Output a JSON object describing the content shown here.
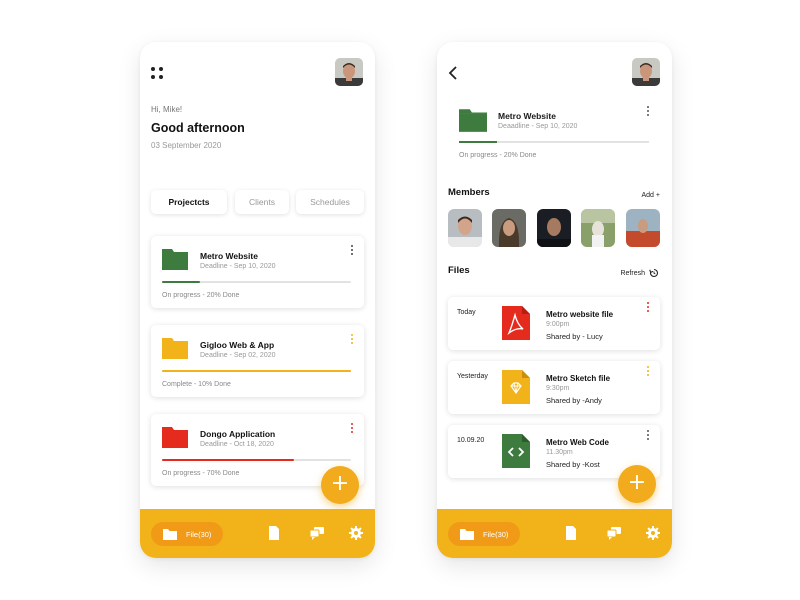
{
  "colors": {
    "accent": "#f1b21a",
    "accent_dark": "#f19a17",
    "green": "#3e7b3e",
    "yellow": "#f1b21a",
    "red": "#e52a1e"
  },
  "left": {
    "greeting_sub": "Hi, Mike!",
    "greeting_title": "Good afternoon",
    "date": "03 September 2020",
    "tabs": [
      {
        "label": "Projectcts",
        "active": true
      },
      {
        "label": "Clients",
        "active": false
      },
      {
        "label": "Schedules",
        "active": false
      }
    ],
    "projects": [
      {
        "title": "Metro Website",
        "deadline": "Deadline - Sep 10, 2020",
        "status": "On progress - 20% Done",
        "progress": 0.2,
        "color": "#3e7b3e"
      },
      {
        "title": "Gigloo Web & App",
        "deadline": "Deadline - Sep 02, 2020",
        "status": "Complete - 10% Done",
        "progress": 1.0,
        "color": "#f1b21a"
      },
      {
        "title": "Dongo Application",
        "deadline": "Deadline - Oct 18, 2020",
        "status": "On progress - 70% Done",
        "progress": 0.7,
        "color": "#e52a1e"
      }
    ],
    "fab_symbol": "+",
    "bottom_bar": {
      "file_label": "File(30)"
    }
  },
  "right": {
    "project": {
      "title": "Metro Website",
      "deadline": "Deaadline - Sep 10, 2020",
      "status": "On progress - 20% Done",
      "progress": 0.2
    },
    "members_title": "Members",
    "add_label": "Add +",
    "files_title": "Files",
    "refresh_label": "Refresh",
    "files": [
      {
        "date": "Today",
        "name": "Metro website file",
        "time": "9:00pm",
        "shared": "Shared by - Lucy",
        "icon": "pdf-icon",
        "kebab_color": "#e52a1e"
      },
      {
        "date": "Yesterday",
        "name": "Metro Sketch file",
        "time": "9:30pm",
        "shared": "Shared by -Andy",
        "icon": "sketch-icon",
        "kebab_color": "#f1b21a"
      },
      {
        "date": "10.09.20",
        "name": "Metro Web Code",
        "time": "11.30pm",
        "shared": "Shared by -Kost",
        "icon": "code-icon",
        "kebab_color": "#555555"
      }
    ],
    "fab_symbol": "+",
    "bottom_bar": {
      "file_label": "File(30)"
    }
  }
}
